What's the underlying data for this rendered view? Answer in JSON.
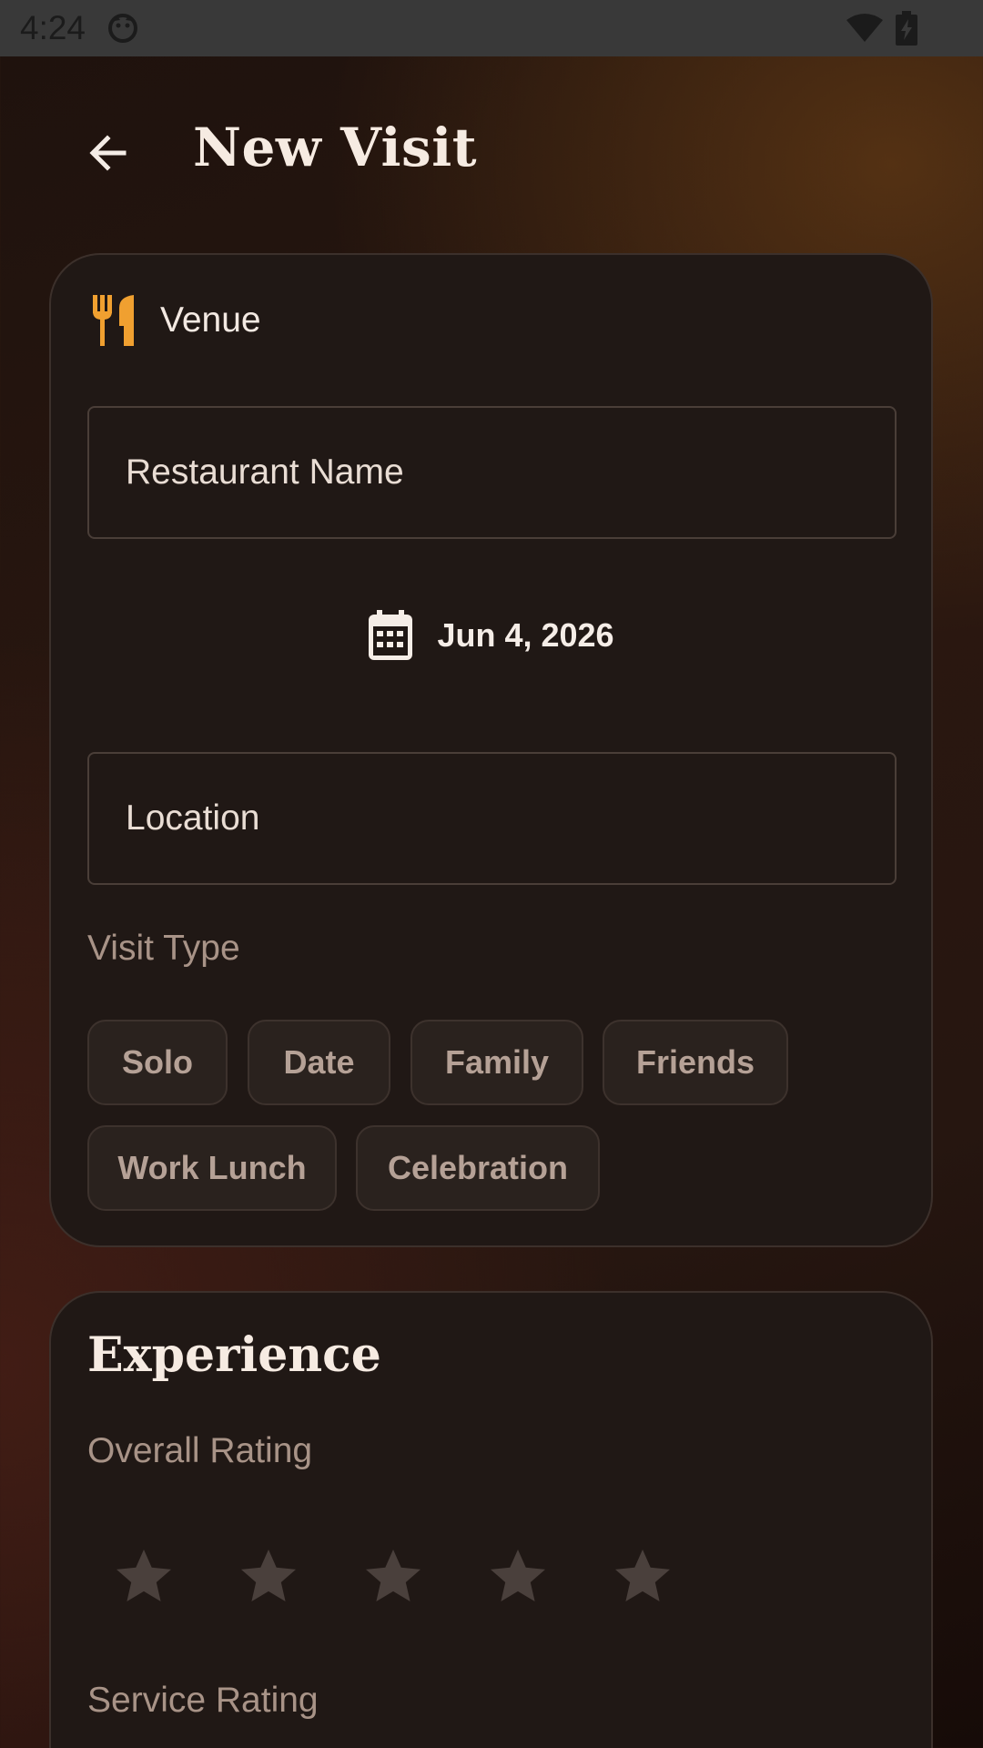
{
  "status_bar": {
    "time": "4:24"
  },
  "header": {
    "title": "New Visit",
    "back_icon": "arrow-back-icon"
  },
  "venue_card": {
    "section_label": "Venue",
    "section_icon": "restaurant-icon",
    "restaurant_name_placeholder": "Restaurant Name",
    "date_icon": "calendar-icon",
    "date_label": "Jun 4, 2026",
    "location_placeholder": "Location",
    "visit_type_label": "Visit Type",
    "visit_types": [
      "Solo",
      "Date",
      "Family",
      "Friends",
      "Work Lunch",
      "Celebration"
    ]
  },
  "experience_card": {
    "title": "Experience",
    "overall_rating_label": "Overall Rating",
    "overall_rating_value": 0,
    "overall_rating_max": 5,
    "service_rating_label": "Service Rating"
  },
  "colors": {
    "accent": "#f0a030",
    "card_bg": "#201815",
    "text_primary": "#f6ebe2",
    "text_muted": "#a89387",
    "star_inactive": "#4a403c"
  }
}
